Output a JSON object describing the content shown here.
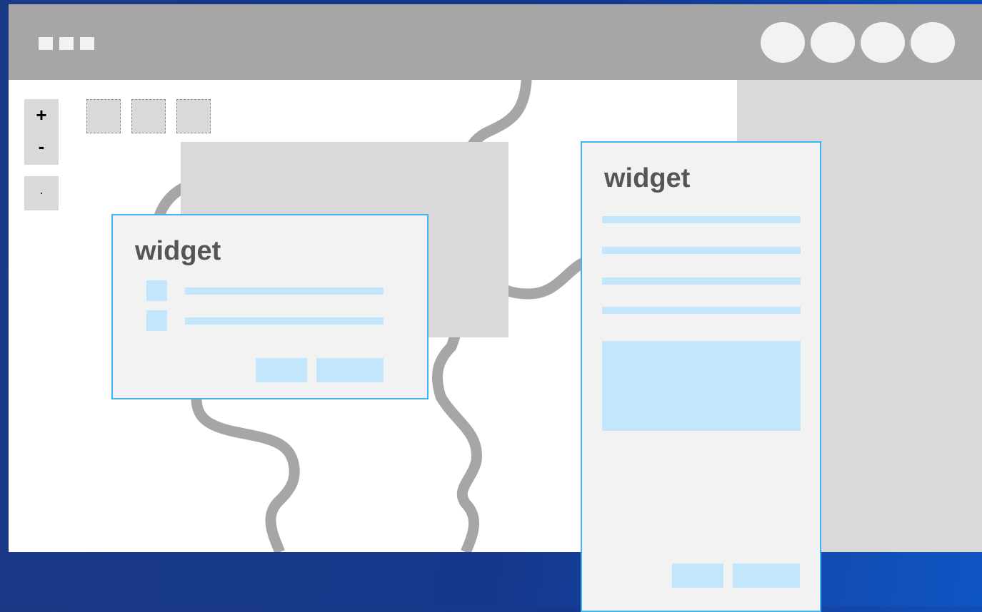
{
  "header": {
    "menu_icon": "menu-squares-icon",
    "header_icons": [
      "circle-icon-1",
      "circle-icon-2",
      "circle-icon-3",
      "circle-icon-4"
    ]
  },
  "map_controls": {
    "zoom_in_label": "+",
    "zoom_out_label": "-",
    "home_label": "·"
  },
  "widgets": [
    {
      "title": "widget",
      "rows": 2,
      "buttons": 2
    },
    {
      "title": "widget",
      "lines": 4,
      "buttons": 2
    }
  ],
  "colors": {
    "background_start": "#1b3a86",
    "background_end": "#0f55c4",
    "header": "#a6a6a6",
    "panel": "#d9d9d9",
    "widget_border": "#3eb4f0",
    "widget_fill": "#f2f2f2",
    "placeholder": "#c2e6fb",
    "river": "#a6a6a6",
    "title_text": "#555555"
  }
}
